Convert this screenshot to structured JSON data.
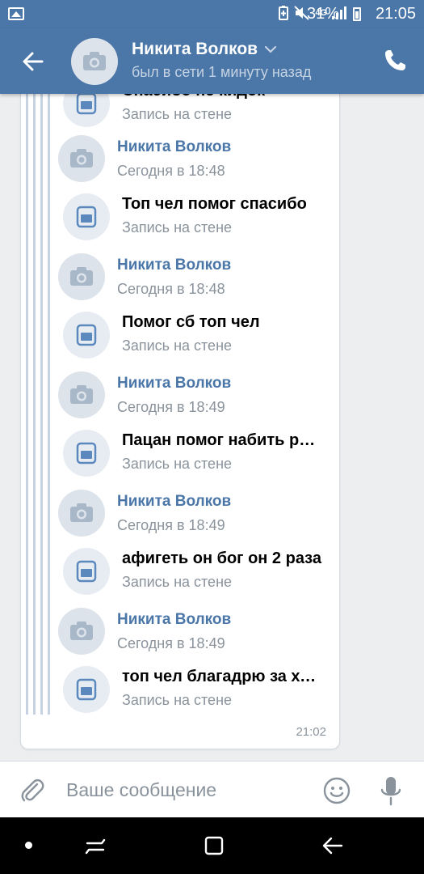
{
  "status_bar": {
    "battery_percent": "31%",
    "time": "21:05",
    "network": "4G"
  },
  "header": {
    "contact_name": "Никита Волков",
    "status": "был в сети 1 минуту назад"
  },
  "forwarded": {
    "first_post_title": "Спасибо не кидок",
    "first_post_subtitle": "Запись на стене",
    "items": [
      {
        "name": "Никита Волков",
        "time": "Сегодня в 18:48",
        "post_title": "Топ чел помог спасибо",
        "post_subtitle": "Запись на стене"
      },
      {
        "name": "Никита Волков",
        "time": "Сегодня в 18:48",
        "post_title": "Помог сб топ чел",
        "post_subtitle": "Запись на стене"
      },
      {
        "name": "Никита Волков",
        "time": "Сегодня в 18:49",
        "post_title": "Пацан помог набить ранг",
        "post_subtitle": "Запись на стене"
      },
      {
        "name": "Никита Волков",
        "time": "Сегодня в 18:49",
        "post_title": "афигеть он бог он 2 раза",
        "post_subtitle": "Запись на стене"
      },
      {
        "name": "Никита Волков",
        "time": "Сегодня в 18:49",
        "post_title": "топ чел благадрю за хелп",
        "post_subtitle": "Запись на стене"
      }
    ],
    "message_time": "21:02"
  },
  "composer": {
    "placeholder": "Ваше сообщение"
  },
  "colors": {
    "accent": "#4a76a8",
    "link": "#4a76a8",
    "secondary_text": "#8a939c",
    "background": "#edeef0"
  }
}
